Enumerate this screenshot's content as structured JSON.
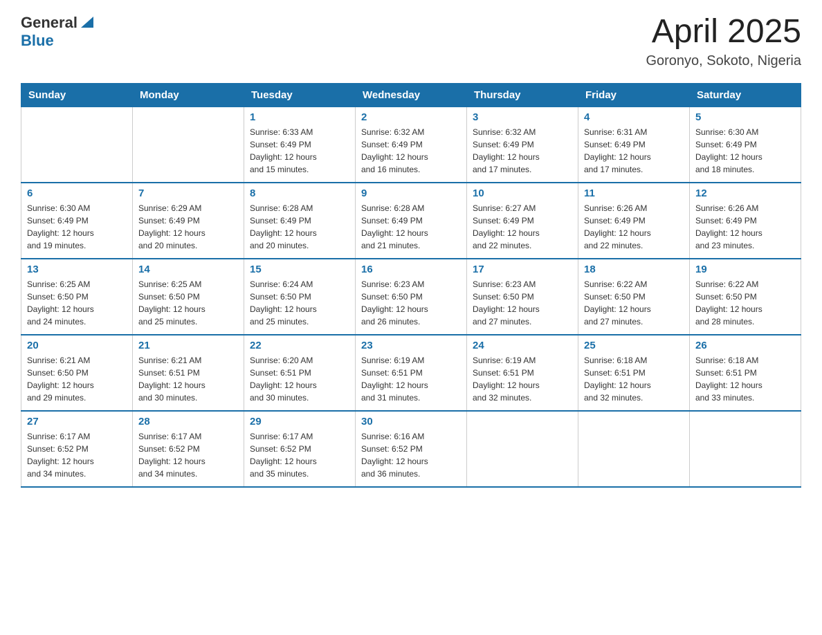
{
  "header": {
    "logo_general": "General",
    "logo_blue": "Blue",
    "title": "April 2025",
    "subtitle": "Goronyo, Sokoto, Nigeria"
  },
  "days_of_week": [
    "Sunday",
    "Monday",
    "Tuesday",
    "Wednesday",
    "Thursday",
    "Friday",
    "Saturday"
  ],
  "weeks": [
    [
      {
        "day": "",
        "info": ""
      },
      {
        "day": "",
        "info": ""
      },
      {
        "day": "1",
        "info": "Sunrise: 6:33 AM\nSunset: 6:49 PM\nDaylight: 12 hours\nand 15 minutes."
      },
      {
        "day": "2",
        "info": "Sunrise: 6:32 AM\nSunset: 6:49 PM\nDaylight: 12 hours\nand 16 minutes."
      },
      {
        "day": "3",
        "info": "Sunrise: 6:32 AM\nSunset: 6:49 PM\nDaylight: 12 hours\nand 17 minutes."
      },
      {
        "day": "4",
        "info": "Sunrise: 6:31 AM\nSunset: 6:49 PM\nDaylight: 12 hours\nand 17 minutes."
      },
      {
        "day": "5",
        "info": "Sunrise: 6:30 AM\nSunset: 6:49 PM\nDaylight: 12 hours\nand 18 minutes."
      }
    ],
    [
      {
        "day": "6",
        "info": "Sunrise: 6:30 AM\nSunset: 6:49 PM\nDaylight: 12 hours\nand 19 minutes."
      },
      {
        "day": "7",
        "info": "Sunrise: 6:29 AM\nSunset: 6:49 PM\nDaylight: 12 hours\nand 20 minutes."
      },
      {
        "day": "8",
        "info": "Sunrise: 6:28 AM\nSunset: 6:49 PM\nDaylight: 12 hours\nand 20 minutes."
      },
      {
        "day": "9",
        "info": "Sunrise: 6:28 AM\nSunset: 6:49 PM\nDaylight: 12 hours\nand 21 minutes."
      },
      {
        "day": "10",
        "info": "Sunrise: 6:27 AM\nSunset: 6:49 PM\nDaylight: 12 hours\nand 22 minutes."
      },
      {
        "day": "11",
        "info": "Sunrise: 6:26 AM\nSunset: 6:49 PM\nDaylight: 12 hours\nand 22 minutes."
      },
      {
        "day": "12",
        "info": "Sunrise: 6:26 AM\nSunset: 6:49 PM\nDaylight: 12 hours\nand 23 minutes."
      }
    ],
    [
      {
        "day": "13",
        "info": "Sunrise: 6:25 AM\nSunset: 6:50 PM\nDaylight: 12 hours\nand 24 minutes."
      },
      {
        "day": "14",
        "info": "Sunrise: 6:25 AM\nSunset: 6:50 PM\nDaylight: 12 hours\nand 25 minutes."
      },
      {
        "day": "15",
        "info": "Sunrise: 6:24 AM\nSunset: 6:50 PM\nDaylight: 12 hours\nand 25 minutes."
      },
      {
        "day": "16",
        "info": "Sunrise: 6:23 AM\nSunset: 6:50 PM\nDaylight: 12 hours\nand 26 minutes."
      },
      {
        "day": "17",
        "info": "Sunrise: 6:23 AM\nSunset: 6:50 PM\nDaylight: 12 hours\nand 27 minutes."
      },
      {
        "day": "18",
        "info": "Sunrise: 6:22 AM\nSunset: 6:50 PM\nDaylight: 12 hours\nand 27 minutes."
      },
      {
        "day": "19",
        "info": "Sunrise: 6:22 AM\nSunset: 6:50 PM\nDaylight: 12 hours\nand 28 minutes."
      }
    ],
    [
      {
        "day": "20",
        "info": "Sunrise: 6:21 AM\nSunset: 6:50 PM\nDaylight: 12 hours\nand 29 minutes."
      },
      {
        "day": "21",
        "info": "Sunrise: 6:21 AM\nSunset: 6:51 PM\nDaylight: 12 hours\nand 30 minutes."
      },
      {
        "day": "22",
        "info": "Sunrise: 6:20 AM\nSunset: 6:51 PM\nDaylight: 12 hours\nand 30 minutes."
      },
      {
        "day": "23",
        "info": "Sunrise: 6:19 AM\nSunset: 6:51 PM\nDaylight: 12 hours\nand 31 minutes."
      },
      {
        "day": "24",
        "info": "Sunrise: 6:19 AM\nSunset: 6:51 PM\nDaylight: 12 hours\nand 32 minutes."
      },
      {
        "day": "25",
        "info": "Sunrise: 6:18 AM\nSunset: 6:51 PM\nDaylight: 12 hours\nand 32 minutes."
      },
      {
        "day": "26",
        "info": "Sunrise: 6:18 AM\nSunset: 6:51 PM\nDaylight: 12 hours\nand 33 minutes."
      }
    ],
    [
      {
        "day": "27",
        "info": "Sunrise: 6:17 AM\nSunset: 6:52 PM\nDaylight: 12 hours\nand 34 minutes."
      },
      {
        "day": "28",
        "info": "Sunrise: 6:17 AM\nSunset: 6:52 PM\nDaylight: 12 hours\nand 34 minutes."
      },
      {
        "day": "29",
        "info": "Sunrise: 6:17 AM\nSunset: 6:52 PM\nDaylight: 12 hours\nand 35 minutes."
      },
      {
        "day": "30",
        "info": "Sunrise: 6:16 AM\nSunset: 6:52 PM\nDaylight: 12 hours\nand 36 minutes."
      },
      {
        "day": "",
        "info": ""
      },
      {
        "day": "",
        "info": ""
      },
      {
        "day": "",
        "info": ""
      }
    ]
  ]
}
